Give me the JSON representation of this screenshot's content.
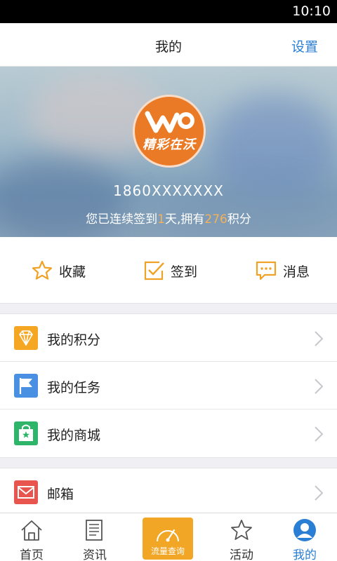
{
  "status": {
    "time": "10:10"
  },
  "header": {
    "title": "我的",
    "settings": "设置"
  },
  "profile": {
    "avatar_text": "精彩在沃",
    "phone": "1860XXXXXXX",
    "signin": {
      "prefix": "您已连续签到",
      "days": "1",
      "mid": "天,拥有",
      "points": "276",
      "suffix": "积分"
    }
  },
  "quick_actions": [
    {
      "label": "收藏",
      "icon": "star-outline-icon"
    },
    {
      "label": "签到",
      "icon": "checkin-icon"
    },
    {
      "label": "消息",
      "icon": "message-icon"
    }
  ],
  "menu_group_1": [
    {
      "label": "我的积分",
      "icon": "diamond-icon",
      "color": "#f5a623"
    },
    {
      "label": "我的任务",
      "icon": "flag-icon",
      "color": "#4a90e2"
    },
    {
      "label": "我的商城",
      "icon": "shopping-bag-icon",
      "color": "#2fb56a"
    }
  ],
  "menu_group_2": [
    {
      "label": "邮箱",
      "icon": "mail-icon",
      "color": "#e8554e"
    }
  ],
  "tabbar": {
    "items": [
      {
        "label": "首页",
        "icon": "home-icon"
      },
      {
        "label": "资讯",
        "icon": "news-icon"
      },
      {
        "label": "流量查询",
        "icon": "speedometer-icon"
      },
      {
        "label": "活动",
        "icon": "star-icon"
      },
      {
        "label": "我的",
        "icon": "user-icon"
      }
    ],
    "active": "我的",
    "accent": "#2a7fd4",
    "center_color": "#f2a626"
  }
}
